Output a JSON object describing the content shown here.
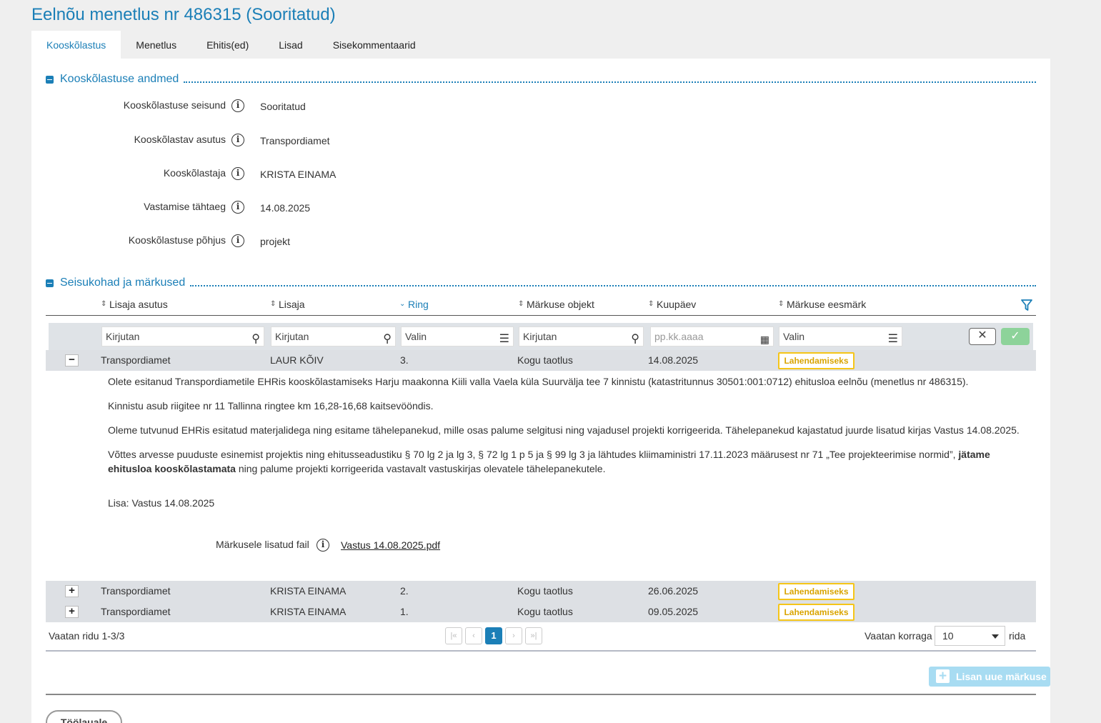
{
  "title": "Eelnõu menetlus nr 486315 (Sooritatud)",
  "tabs": [
    "Kooskõlastus",
    "Menetlus",
    "Ehitis(ed)",
    "Lisad",
    "Sisekommentaarid"
  ],
  "section1": {
    "title": "Kooskõlastuse andmed",
    "fields": [
      {
        "label": "Kooskõlastuse seisund",
        "value": "Sooritatud"
      },
      {
        "label": "Kooskõlastav asutus",
        "value": "Transpordiamet"
      },
      {
        "label": "Kooskõlastaja",
        "value": "KRISTA EINAMA"
      },
      {
        "label": "Vastamise tähtaeg",
        "value": "14.08.2025"
      },
      {
        "label": "Kooskõlastuse põhjus",
        "value": "projekt"
      }
    ]
  },
  "section2": {
    "title": "Seisukohad ja märkused",
    "columns": [
      "Lisaja asutus",
      "Lisaja",
      "Ring",
      "Märkuse objekt",
      "Kuupäev",
      "Märkuse eesmärk"
    ],
    "filters": [
      "Kirjutan",
      "Kirjutan",
      "Valin",
      "Kirjutan",
      "pp.kk.aaaa",
      "Valin"
    ],
    "rows": [
      {
        "asutus": "Transpordiamet",
        "lisaja": "LAUR KÕIV",
        "ring": "3.",
        "objekt": "Kogu taotlus",
        "kuupaev": "14.08.2025",
        "eesmark": "Lahendamiseks",
        "toggle": "−"
      },
      {
        "asutus": "Transpordiamet",
        "lisaja": "KRISTA EINAMA",
        "ring": "2.",
        "objekt": "Kogu taotlus",
        "kuupaev": "26.06.2025",
        "eesmark": "Lahendamiseks",
        "toggle": "+"
      },
      {
        "asutus": "Transpordiamet",
        "lisaja": "KRISTA EINAMA",
        "ring": "1.",
        "objekt": "Kogu taotlus",
        "kuupaev": "09.05.2025",
        "eesmark": "Lahendamiseks",
        "toggle": "+"
      }
    ],
    "detail": {
      "p1": "Olete esitanud Transpordiametile EHRis kooskõlastamiseks Harju maakonna Kiili valla Vaela  küla Suurvälja tee 7 kinnistu (katastritunnus 30501:001:0712) ehitusloa eelnõu (menetlus nr 486315).",
      "p2": "Kinnistu asub riigitee nr 11 Tallinna ringtee km 16,28-16,68 kaitsevööndis.",
      "p3": "Oleme tutvunud EHRis esitatud materjalidega ning esitame tähelepanekud, mille osas palume selgitusi ning vajadusel projekti korrigeerida. Tähelepanekud kajastatud juurde lisatud kirjas Vastus 14.08.2025.",
      "p4a": "Võttes arvesse puuduste esinemist projektis ning ehitusseadustiku § 70 lg 2 ja lg 3, § 72 lg 1 p 5 ja § 99 lg 3 ja lähtudes kliimaministri 17.11.2023 määrusest nr 71 „Tee projekteerimise normid”, ",
      "p4b": "jätame ehitusloa kooskõlastamata",
      "p4c": " ning palume projekti korrigeerida vastavalt vastuskirjas olevatele tähelepanekutele.",
      "lisa": "Lisa: Vastus 14.08.2025",
      "file_label": "Märkusele lisatud fail",
      "file_name": "Vastus 14.08.2025.pdf"
    },
    "pager": {
      "summary": "Vaatan ridu 1-3/3",
      "first": "|«",
      "prev": "‹",
      "current": "1",
      "next": "›",
      "last": "»|",
      "per_page_label": "Vaatan korraga",
      "per_page": "10",
      "rows_label": "rida"
    },
    "add_button": "Lisan uue märkuse"
  },
  "back_button": "Töölauale",
  "colors": {
    "accent": "#1b7fb7",
    "badge": "#f5c518",
    "row_bg": "#dde0e4"
  }
}
